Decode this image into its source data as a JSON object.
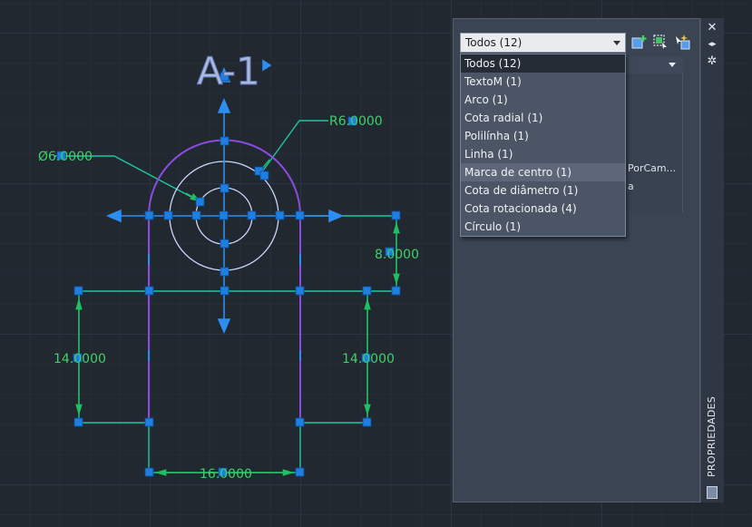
{
  "drawing": {
    "title_text": "A-1",
    "dimensions": {
      "diameter": "Ø6.0000",
      "radius": "R6.0000",
      "vertical_right": "8.0000",
      "left_height": "14.0000",
      "right_height": "14.0000",
      "bottom_width": "16.0000"
    }
  },
  "properties_panel": {
    "selection_combo": "Todos (12)",
    "selection_options": [
      "Todos (12)",
      "TextoM (1)",
      "Arco (1)",
      "Cota radial (1)",
      "Polilínha (1)",
      "Linha (1)",
      "Marca de centro (1)",
      "Cota de diâmetro (1)",
      "Cota rotacionada (4)",
      "Círculo (1)"
    ],
    "grid_value_1": "PorCam...",
    "grid_value_2": "a",
    "side_label": "PROPRIEDADES"
  },
  "colors": {
    "background": "#212830",
    "geometry": "#9fc6ff",
    "arc": "#8a4ce0",
    "dimension": "#1cc7a0",
    "grip": "#1e7fe0",
    "dimension_text": "#3fd06a"
  }
}
